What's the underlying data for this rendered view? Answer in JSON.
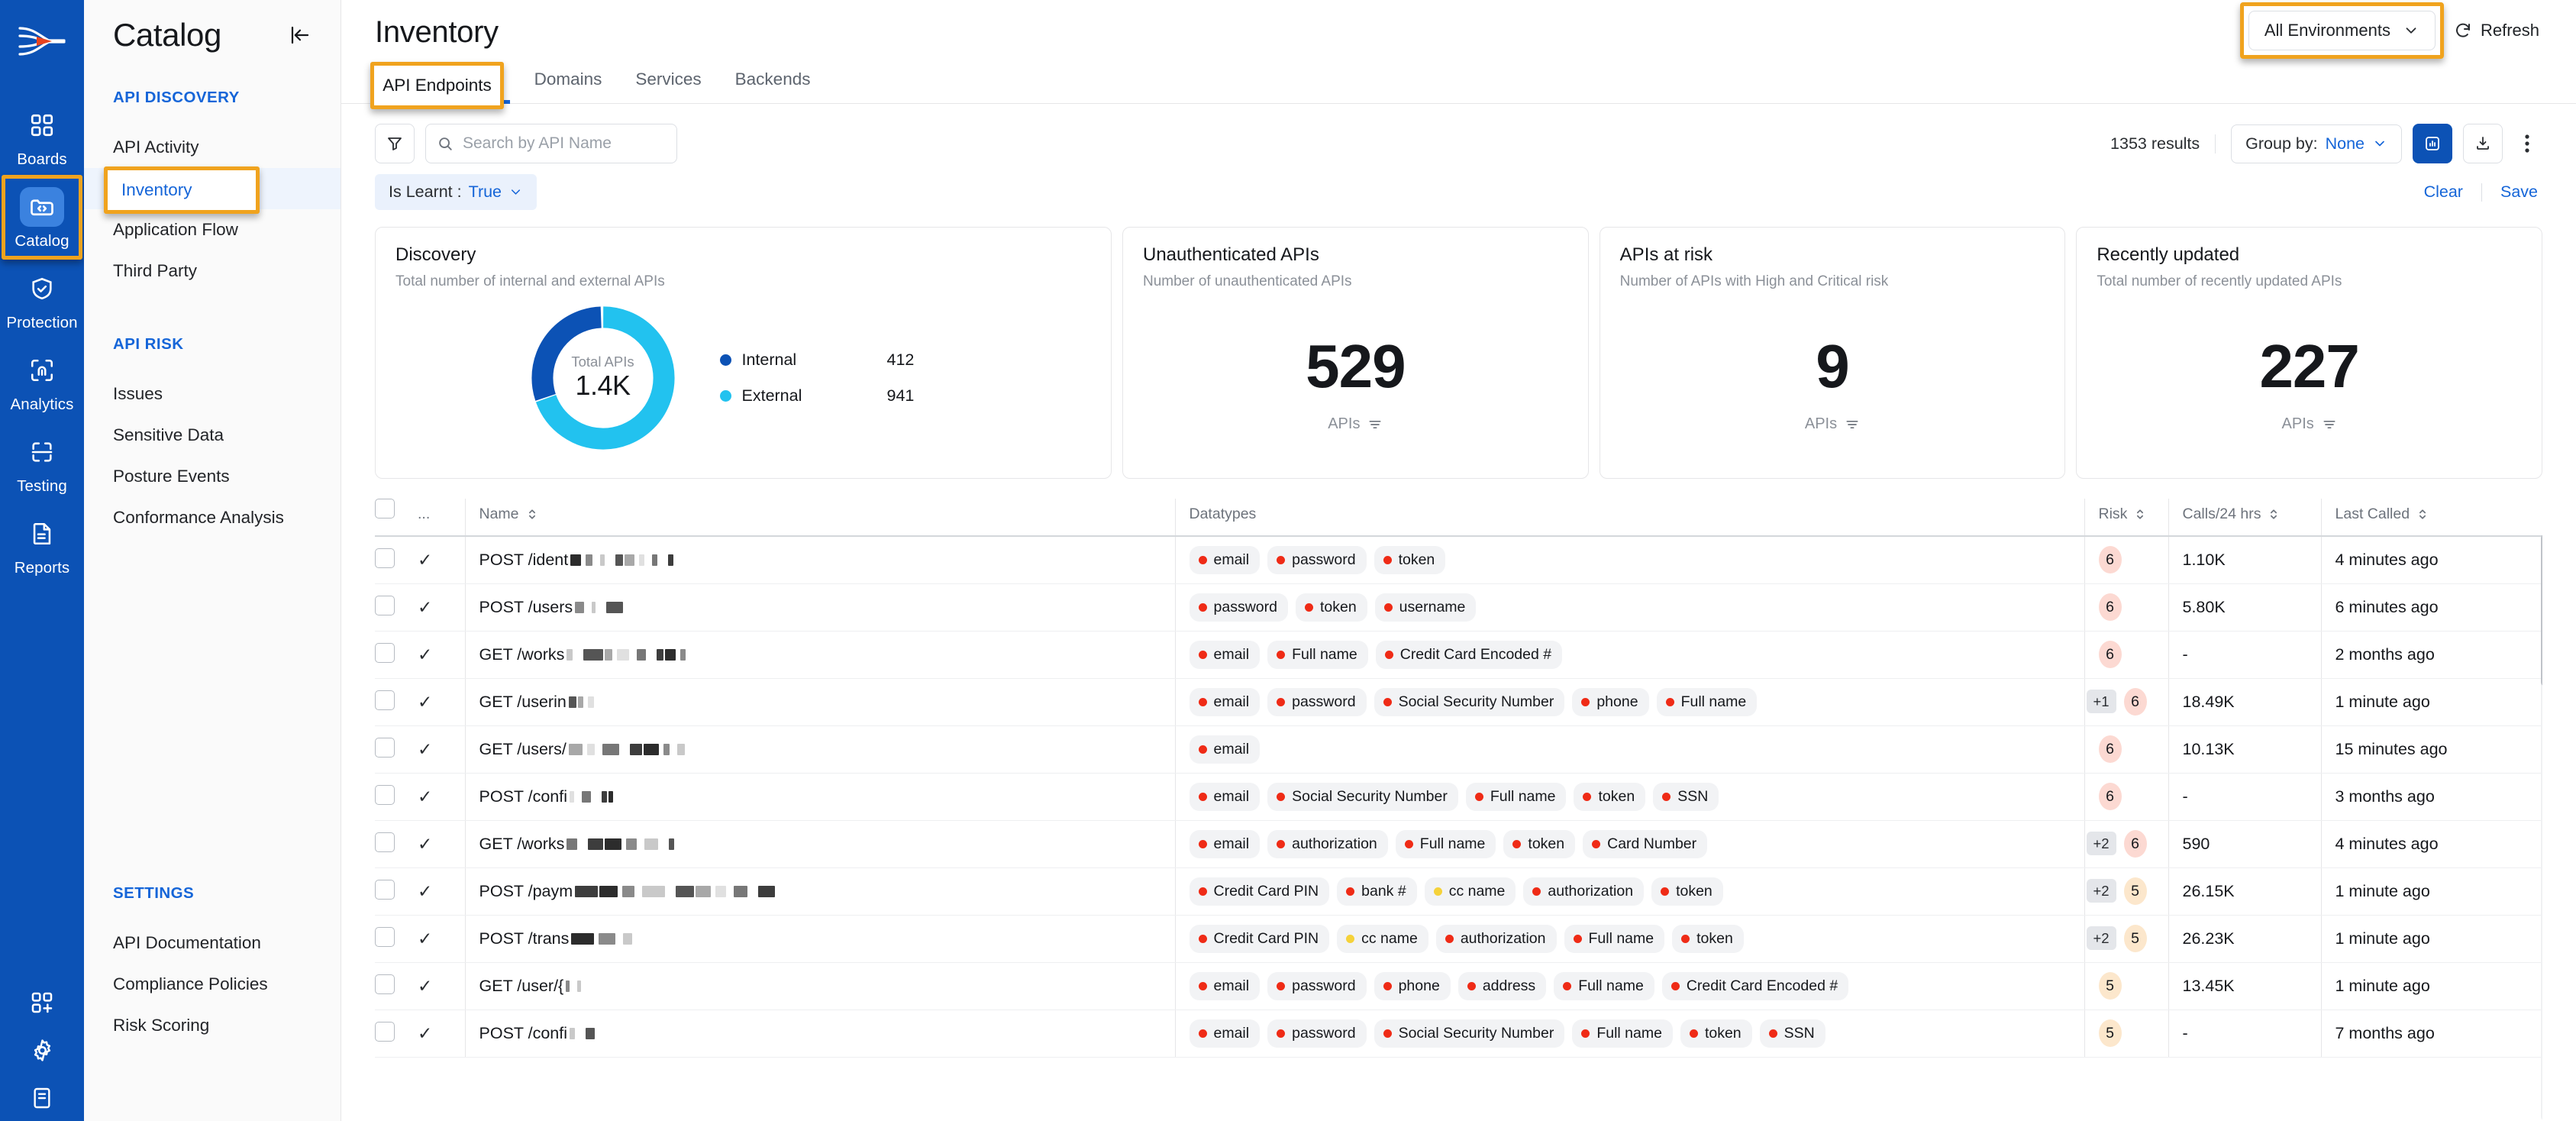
{
  "rail": {
    "logo_icon": "apisec-logo-icon",
    "items": [
      {
        "label": "Boards",
        "icon": "grid-icon",
        "active": false
      },
      {
        "label": "Catalog",
        "icon": "code-folder-icon",
        "active": true
      },
      {
        "label": "Protection",
        "icon": "shield-check-icon",
        "active": false
      },
      {
        "label": "Analytics",
        "icon": "fingerprint-scan-icon",
        "active": false
      },
      {
        "label": "Testing",
        "icon": "test-scan-icon",
        "active": false
      },
      {
        "label": "Reports",
        "icon": "report-document-icon",
        "active": false
      }
    ],
    "bottom_icons": [
      "grid-plus-icon",
      "gear-icon",
      "book-icon"
    ]
  },
  "sidebar": {
    "title": "Catalog",
    "collapse_icon": "collapse-panel-icon",
    "groups": [
      {
        "label": "API DISCOVERY",
        "items": [
          {
            "label": "API Activity",
            "active": false
          },
          {
            "label": "Inventory",
            "active": true
          },
          {
            "label": "Application Flow",
            "active": false
          },
          {
            "label": "Third Party",
            "active": false
          }
        ]
      },
      {
        "label": "API RISK",
        "items": [
          {
            "label": "Issues",
            "active": false
          },
          {
            "label": "Sensitive Data",
            "active": false
          },
          {
            "label": "Posture Events",
            "active": false
          },
          {
            "label": "Conformance Analysis",
            "active": false
          }
        ]
      },
      {
        "label": "SETTINGS",
        "items": [
          {
            "label": "API Documentation",
            "active": false
          },
          {
            "label": "Compliance Policies",
            "active": false
          },
          {
            "label": "Risk Scoring",
            "active": false
          }
        ]
      }
    ]
  },
  "header": {
    "page_title": "Inventory",
    "environment_selector": "All Environments",
    "environment_chevron_icon": "chevron-down-icon",
    "refresh_label": "Refresh",
    "refresh_icon": "refresh-icon"
  },
  "tabs": [
    {
      "label": "API Endpoints",
      "active": true
    },
    {
      "label": "Domains",
      "active": false
    },
    {
      "label": "Services",
      "active": false
    },
    {
      "label": "Backends",
      "active": false
    }
  ],
  "toolbar": {
    "filter_icon": "funnel-filter-icon",
    "search_icon": "search-icon",
    "search_value": "",
    "search_placeholder": "Search by API Name",
    "results_count": "1353 results",
    "group_by_label": "Group by:",
    "group_by_value": "None",
    "group_by_chevron_icon": "chevron-down-icon",
    "chart_toggle_icon": "bar-chart-icon",
    "download_icon": "download-icon",
    "more_icon": "kebab-menu-icon"
  },
  "filters": {
    "chip_label": "Is Learnt :",
    "chip_value": "True",
    "chip_chevron_icon": "chevron-down-icon",
    "clear_label": "Clear",
    "save_label": "Save"
  },
  "cards": {
    "discovery": {
      "title": "Discovery",
      "subtitle": "Total number of internal and external APIs",
      "center_label": "Total APIs",
      "center_value": "1.4K"
    },
    "stats": [
      {
        "title": "Unauthenticated APIs",
        "subtitle": "Number of unauthenticated APIs",
        "value": "529",
        "foot": "APIs",
        "foot_icon": "filter-lines-icon"
      },
      {
        "title": "APIs at risk",
        "subtitle": "Number of APIs with High and Critical risk",
        "value": "9",
        "foot": "APIs",
        "foot_icon": "filter-lines-icon"
      },
      {
        "title": "Recently updated",
        "subtitle": "Total number of recently updated APIs",
        "value": "227",
        "foot": "APIs",
        "foot_icon": "filter-lines-icon"
      }
    ]
  },
  "chart_data": {
    "type": "pie",
    "title": "Discovery",
    "subtitle": "Total number of internal and external APIs",
    "center_label": "Total APIs",
    "center_value": "1.4K",
    "categories": [
      "Internal",
      "External"
    ],
    "values": [
      412,
      941
    ],
    "colors": [
      "#0c52b5",
      "#22c2ef"
    ],
    "legend": "right",
    "donut": true
  },
  "table": {
    "columns": [
      {
        "key": "checkbox",
        "label": "",
        "sortable": false
      },
      {
        "key": "dots",
        "label": "...",
        "sortable": false
      },
      {
        "key": "name",
        "label": "Name",
        "sortable": true
      },
      {
        "key": "datatypes",
        "label": "Datatypes",
        "sortable": false
      },
      {
        "key": "risk",
        "label": "Risk",
        "sortable": true
      },
      {
        "key": "calls",
        "label": "Calls/24 hrs",
        "sortable": true
      },
      {
        "key": "last_called",
        "label": "Last Called",
        "sortable": true
      }
    ],
    "rows": [
      {
        "name": "POST /ident",
        "redacted_widths": [
          14,
          9,
          6,
          10,
          13,
          7,
          7,
          7
        ],
        "datatypes": [
          {
            "label": "email",
            "color": "#ef2b16"
          },
          {
            "label": "password",
            "color": "#ef2b16"
          },
          {
            "label": "token",
            "color": "#ef2b16"
          }
        ],
        "overflow": "",
        "risk": "6",
        "risk_color": "#fcd9d2",
        "calls": "1.10K",
        "last_called": "4 minutes ago"
      },
      {
        "name": "POST /users",
        "redacted_widths": [
          12,
          5,
          22
        ],
        "datatypes": [
          {
            "label": "password",
            "color": "#ef2b16"
          },
          {
            "label": "token",
            "color": "#ef2b16"
          },
          {
            "label": "username",
            "color": "#ef2b16"
          }
        ],
        "overflow": "",
        "risk": "6",
        "risk_color": "#fcd9d2",
        "calls": "5.80K",
        "last_called": "6 minutes ago"
      },
      {
        "name": "GET /works",
        "redacted_widths": [
          8,
          26,
          10,
          16,
          12,
          9,
          14,
          7
        ],
        "datatypes": [
          {
            "label": "email",
            "color": "#ef2b16"
          },
          {
            "label": "Full name",
            "color": "#ef2b16"
          },
          {
            "label": "Credit Card Encoded #",
            "color": "#ef2b16"
          }
        ],
        "overflow": "",
        "risk": "6",
        "risk_color": "#fcd9d2",
        "calls": "-",
        "last_called": "2 months ago"
      },
      {
        "name": "GET /userin",
        "redacted_widths": [
          10,
          7,
          8
        ],
        "datatypes": [
          {
            "label": "email",
            "color": "#ef2b16"
          },
          {
            "label": "password",
            "color": "#ef2b16"
          },
          {
            "label": "Social Security Number",
            "color": "#ef2b16"
          },
          {
            "label": "phone",
            "color": "#ef2b16"
          },
          {
            "label": "Full name",
            "color": "#ef2b16"
          }
        ],
        "overflow": "+1",
        "risk": "6",
        "risk_color": "#fcd9d2",
        "calls": "18.49K",
        "last_called": "1 minute ago"
      },
      {
        "name": "GET /users/",
        "redacted_widths": [
          18,
          10,
          22,
          16,
          20,
          8,
          10
        ],
        "datatypes": [
          {
            "label": "email",
            "color": "#ef2b16"
          }
        ],
        "overflow": "",
        "risk": "6",
        "risk_color": "#fcd9d2",
        "calls": "10.13K",
        "last_called": "15 minutes ago"
      },
      {
        "name": "POST /confi",
        "redacted_widths": [
          6,
          12,
          7,
          6
        ],
        "datatypes": [
          {
            "label": "email",
            "color": "#ef2b16"
          },
          {
            "label": "Social Security Number",
            "color": "#ef2b16"
          },
          {
            "label": "Full name",
            "color": "#ef2b16"
          },
          {
            "label": "token",
            "color": "#ef2b16"
          },
          {
            "label": "SSN",
            "color": "#ef2b16"
          }
        ],
        "overflow": "",
        "risk": "6",
        "risk_color": "#fcd9d2",
        "calls": "-",
        "last_called": "3 months ago"
      },
      {
        "name": "GET /works",
        "redacted_widths": [
          14,
          20,
          22,
          14,
          18,
          7
        ],
        "datatypes": [
          {
            "label": "email",
            "color": "#ef2b16"
          },
          {
            "label": "authorization",
            "color": "#ef2b16"
          },
          {
            "label": "Full name",
            "color": "#ef2b16"
          },
          {
            "label": "token",
            "color": "#ef2b16"
          },
          {
            "label": "Card Number",
            "color": "#ef2b16"
          }
        ],
        "overflow": "+2",
        "risk": "6",
        "risk_color": "#fcd9d2",
        "calls": "590",
        "last_called": "4 minutes ago"
      },
      {
        "name": "POST /paym",
        "redacted_widths": [
          30,
          24,
          16,
          30,
          24,
          20,
          14,
          18,
          22
        ],
        "datatypes": [
          {
            "label": "Credit Card PIN",
            "color": "#ef2b16"
          },
          {
            "label": "bank #",
            "color": "#ef2b16"
          },
          {
            "label": "cc name",
            "color": "#f5d23a"
          },
          {
            "label": "authorization",
            "color": "#ef2b16"
          },
          {
            "label": "token",
            "color": "#ef2b16"
          }
        ],
        "overflow": "+2",
        "risk": "5",
        "risk_color": "#fce7cc",
        "calls": "26.15K",
        "last_called": "1 minute ago"
      },
      {
        "name": "POST /trans",
        "redacted_widths": [
          30,
          22,
          12
        ],
        "datatypes": [
          {
            "label": "Credit Card PIN",
            "color": "#ef2b16"
          },
          {
            "label": "cc name",
            "color": "#f5d23a"
          },
          {
            "label": "authorization",
            "color": "#ef2b16"
          },
          {
            "label": "Full name",
            "color": "#ef2b16"
          },
          {
            "label": "token",
            "color": "#ef2b16"
          }
        ],
        "overflow": "+2",
        "risk": "5",
        "risk_color": "#fce7cc",
        "calls": "26.23K",
        "last_called": "1 minute ago"
      },
      {
        "name": "GET /user/{",
        "redacted_widths": [
          5,
          5
        ],
        "datatypes": [
          {
            "label": "email",
            "color": "#ef2b16"
          },
          {
            "label": "password",
            "color": "#ef2b16"
          },
          {
            "label": "phone",
            "color": "#ef2b16"
          },
          {
            "label": "address",
            "color": "#ef2b16"
          },
          {
            "label": "Full name",
            "color": "#ef2b16"
          },
          {
            "label": "Credit Card Encoded #",
            "color": "#ef2b16"
          }
        ],
        "overflow": "",
        "risk": "5",
        "risk_color": "#fce7cc",
        "calls": "13.45K",
        "last_called": "1 minute ago"
      },
      {
        "name": "POST /confi",
        "redacted_widths": [
          7,
          12
        ],
        "datatypes": [
          {
            "label": "email",
            "color": "#ef2b16"
          },
          {
            "label": "password",
            "color": "#ef2b16"
          },
          {
            "label": "Social Security Number",
            "color": "#ef2b16"
          },
          {
            "label": "Full name",
            "color": "#ef2b16"
          },
          {
            "label": "token",
            "color": "#ef2b16"
          },
          {
            "label": "SSN",
            "color": "#ef2b16"
          }
        ],
        "overflow": "",
        "risk": "5",
        "risk_color": "#fce7cc",
        "calls": "-",
        "last_called": "7 months ago"
      }
    ]
  },
  "colors": {
    "brand_blue": "#0c52b5",
    "accent_blue": "#1565d8",
    "cyan": "#22c2ef",
    "highlight_orange": "#f0a31e",
    "risk_high_bg": "#fcd9d2",
    "risk_med_bg": "#fce7cc"
  }
}
